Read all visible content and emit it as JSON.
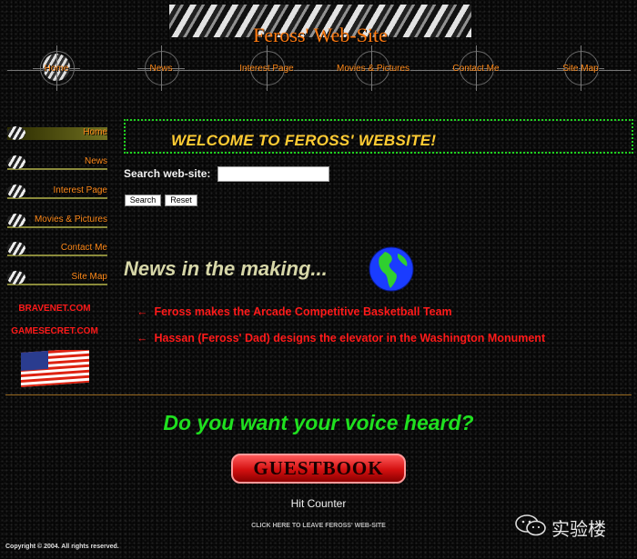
{
  "header": {
    "title": "Feross' Web-Site"
  },
  "topnav": [
    {
      "label": "Home",
      "active": true
    },
    {
      "label": "News"
    },
    {
      "label": "Interest Page"
    },
    {
      "label": "Movies & Pictures"
    },
    {
      "label": "Contact Me"
    },
    {
      "label": "Site Map"
    }
  ],
  "leftnav": [
    {
      "label": "Home",
      "active": true
    },
    {
      "label": "News"
    },
    {
      "label": "Interest Page"
    },
    {
      "label": "Movies & Pictures"
    },
    {
      "label": "Contact Me"
    },
    {
      "label": "Site Map"
    }
  ],
  "sidebar": {
    "links": [
      "BRAVENET.COM",
      "GAMESECRET.COM"
    ]
  },
  "main": {
    "welcome": "WELCOME TO FEROSS' WEBSITE!",
    "search": {
      "label": "Search web-site:",
      "value": "",
      "submit": "Search",
      "reset": "Reset"
    },
    "news_heading": "News in the making...",
    "news_items": [
      "Feross makes the Arcade Competitive Basketball Team",
      "Hassan (Feross' Dad) designs the elevator in the Washington Monument"
    ],
    "news_arrow": "←",
    "voice_prompt": "Do you want your voice heard?",
    "guestbook_button": "GUESTBOOK",
    "hit_counter": "Hit Counter",
    "leave_link": "CLICK HERE TO LEAVE FEROSS' WEB-SITE",
    "copyright": "Copyright © 2004.  All rights reserved."
  },
  "watermark": {
    "text": "实验楼"
  },
  "colors": {
    "nav_orange": "#ff8a1a",
    "link_red": "#ff1a1a",
    "welcome_yellow": "#ffcc33",
    "green_accent": "#1fe01f"
  }
}
